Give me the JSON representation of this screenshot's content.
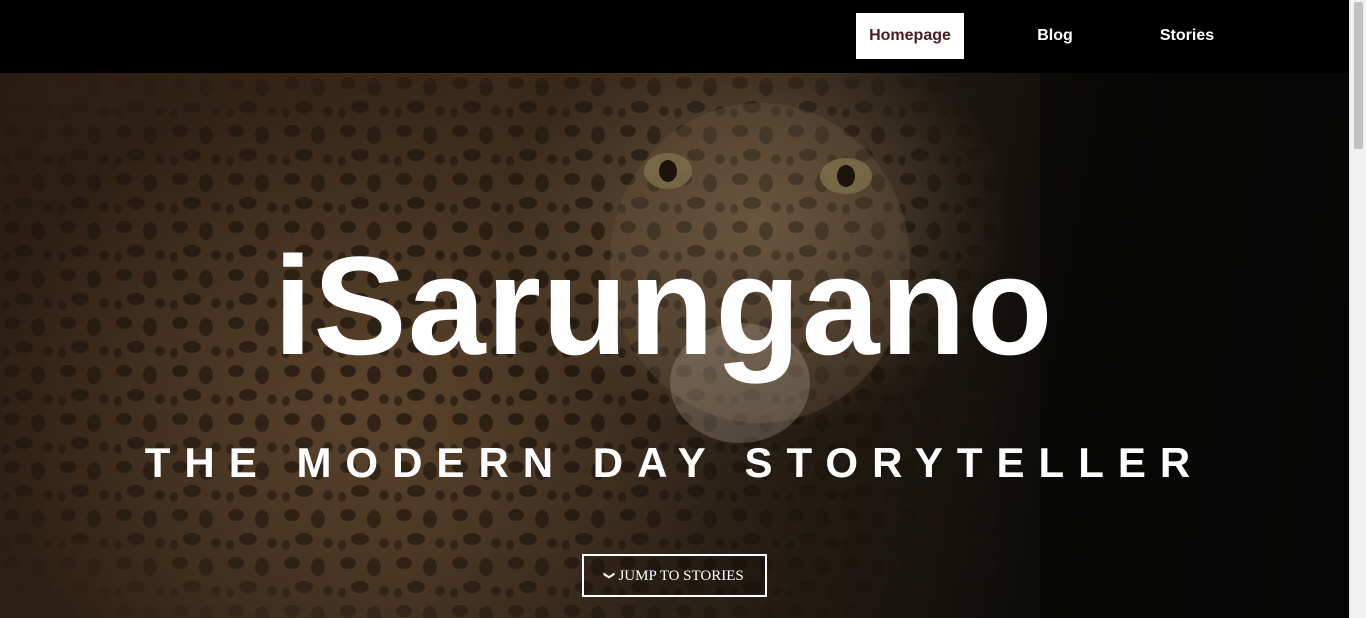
{
  "nav": {
    "items": [
      {
        "label": "Homepage",
        "active": true
      },
      {
        "label": "Blog",
        "active": false
      },
      {
        "label": "Stories",
        "active": false
      }
    ]
  },
  "hero": {
    "title": "iSarungano",
    "subtitle": "THE MODERN DAY STORYTELLER",
    "button_label": "JUMP TO STORIES",
    "button_icon": "chevron-down-icon",
    "background_image": "leopard-photo"
  },
  "colors": {
    "nav_background": "#000000",
    "active_nav_background": "#ffffff",
    "active_nav_text": "#4a1c24",
    "hero_text": "#ffffff"
  },
  "scrollbar": {
    "position_fraction": 0.0
  }
}
